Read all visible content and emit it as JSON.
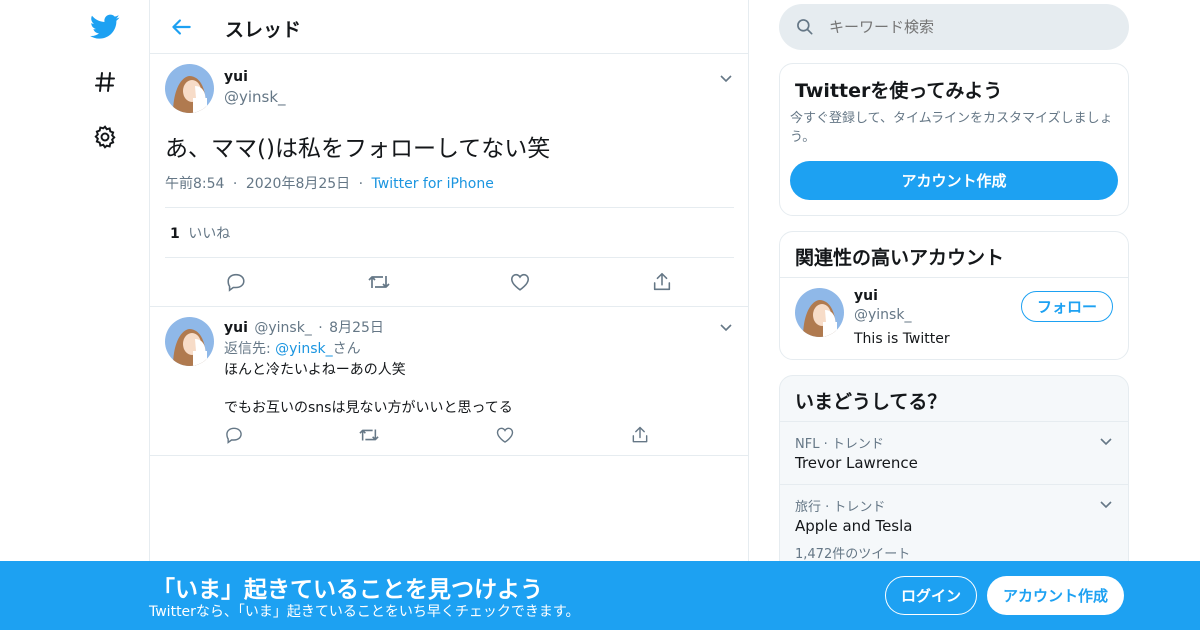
{
  "colors": {
    "accent": "#1da1f2",
    "link": "#1b95e0",
    "muted": "#657786",
    "border": "#e6ecf0"
  },
  "nav": {
    "icons": [
      "twitter-bird-icon",
      "hashtag-icon",
      "gear-icon"
    ]
  },
  "header": {
    "title": "スレッド"
  },
  "main_tweet": {
    "name": "yui",
    "handle": "@yinsk_",
    "text": "あ、ママ()は私をフォローしてない笑",
    "time": "午前8:54",
    "date": "2020年8月25日",
    "source": "Twitter for iPhone",
    "likes_count": "1",
    "likes_label": "いいね"
  },
  "reply_tweet": {
    "name": "yui",
    "handle": "@yinsk_",
    "date": "8月25日",
    "reply_prefix": "返信先: ",
    "reply_handle": "@yinsk_",
    "reply_suffix": "さん",
    "line1": "ほんと冷たいよねーあの人笑",
    "line2": "でもお互いのsnsは見ない方がいいと思ってる"
  },
  "search": {
    "placeholder": "キーワード検索"
  },
  "signup_card": {
    "title": "Twitterを使ってみよう",
    "description": "今すぐ登録して、タイムラインをカスタマイズしましょう。",
    "button": "アカウント作成"
  },
  "related_card": {
    "title": "関連性の高いアカウント",
    "name": "yui",
    "handle": "@yinsk_",
    "bio": "This is Twitter",
    "follow_button": "フォロー"
  },
  "trends_card": {
    "title": "いまどうしてる？",
    "items": [
      {
        "context": "NFL · トレンド",
        "name": "Trevor Lawrence",
        "count": ""
      },
      {
        "context": "旅行 · トレンド",
        "name": "Apple and Tesla",
        "count": "1,472件のツイート"
      }
    ]
  },
  "banner": {
    "title": "「いま」起きていることを見つけよう",
    "subtitle": "Twitterなら、「いま」起きていることをいち早くチェックできます。",
    "login": "ログイン",
    "signup": "アカウント作成"
  }
}
